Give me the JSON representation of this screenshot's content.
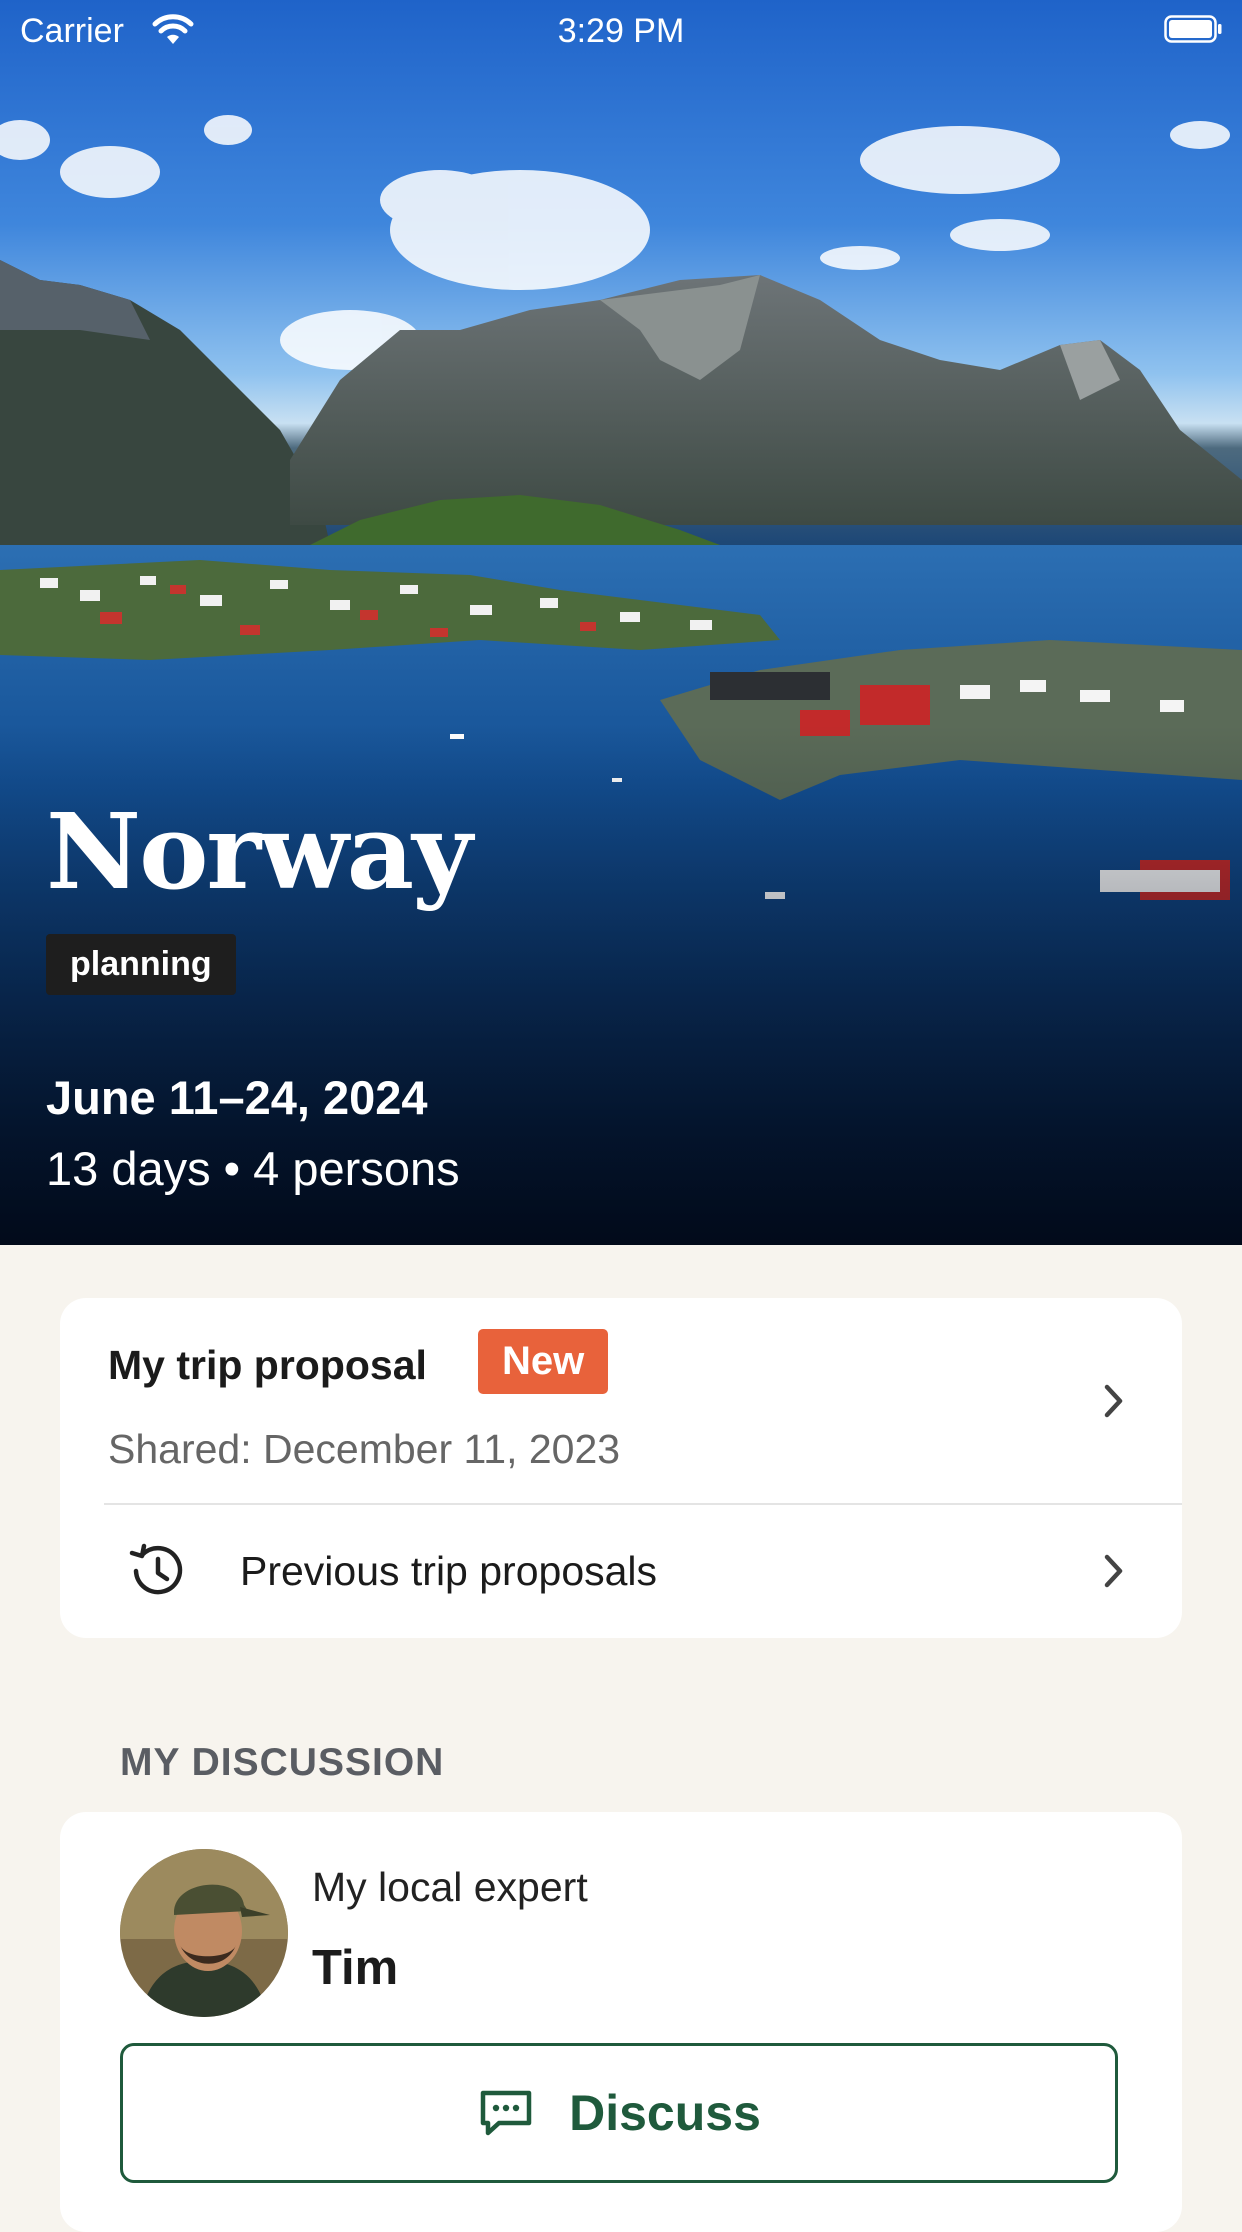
{
  "status_bar": {
    "carrier": "Carrier",
    "time": "3:29 PM"
  },
  "hero": {
    "title": "Norway",
    "status": "planning",
    "dates": "June 11–24, 2024",
    "meta": "13 days • 4 persons"
  },
  "proposal": {
    "title": "My trip proposal",
    "badge": "New",
    "shared": "Shared: December 11, 2023",
    "previous_label": "Previous trip proposals"
  },
  "discussion": {
    "section_label": "MY DISCUSSION",
    "expert_role": "My local expert",
    "expert_name": "Tim",
    "button_label": "Discuss"
  },
  "colors": {
    "accent_green": "#1f5a3c",
    "badge_orange": "#e8623b",
    "page_background": "#f7f4ee"
  },
  "icons": [
    "wifi-icon",
    "battery-icon",
    "chevron-right-icon",
    "history-icon",
    "chat-bubble-icon"
  ]
}
